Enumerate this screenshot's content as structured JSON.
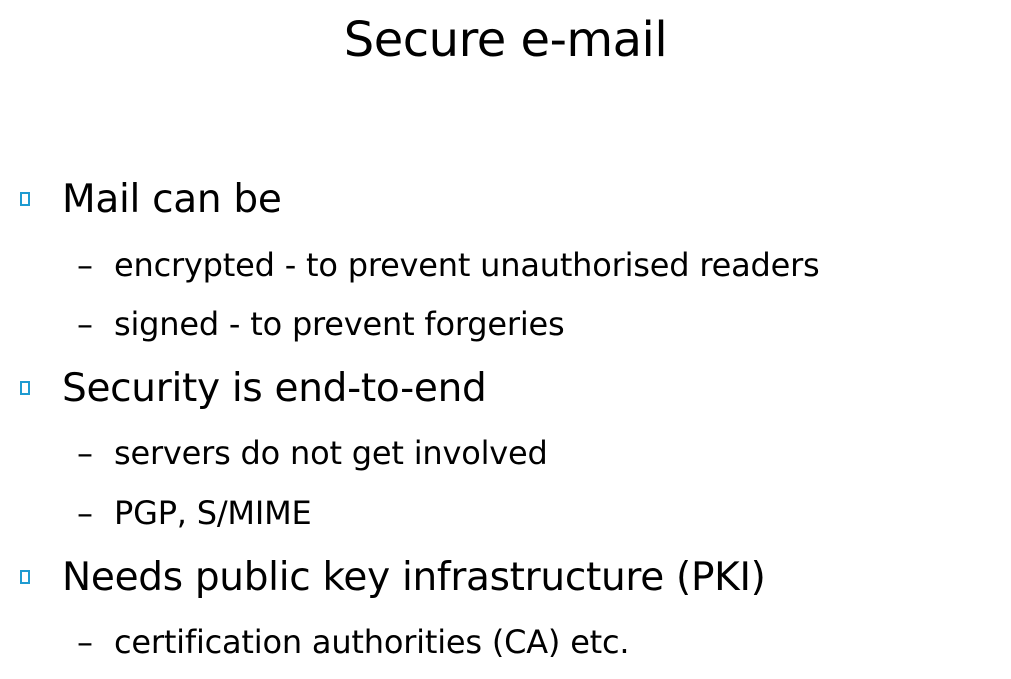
{
  "slide": {
    "title": "Secure e-mail",
    "marker_color": "#1f9bd1",
    "bullets": [
      {
        "text": "Mail can be",
        "subitems": [
          "encrypted - to prevent unauthorised readers",
          "signed - to prevent forgeries"
        ]
      },
      {
        "text": "Security is end-to-end",
        "subitems": [
          "servers do not get involved",
          "PGP, S/MIME"
        ]
      },
      {
        "text": "Needs public key infrastructure (PKI)",
        "subitems": [
          "certification authorities (CA) etc."
        ]
      }
    ],
    "sub_dash": "–"
  }
}
